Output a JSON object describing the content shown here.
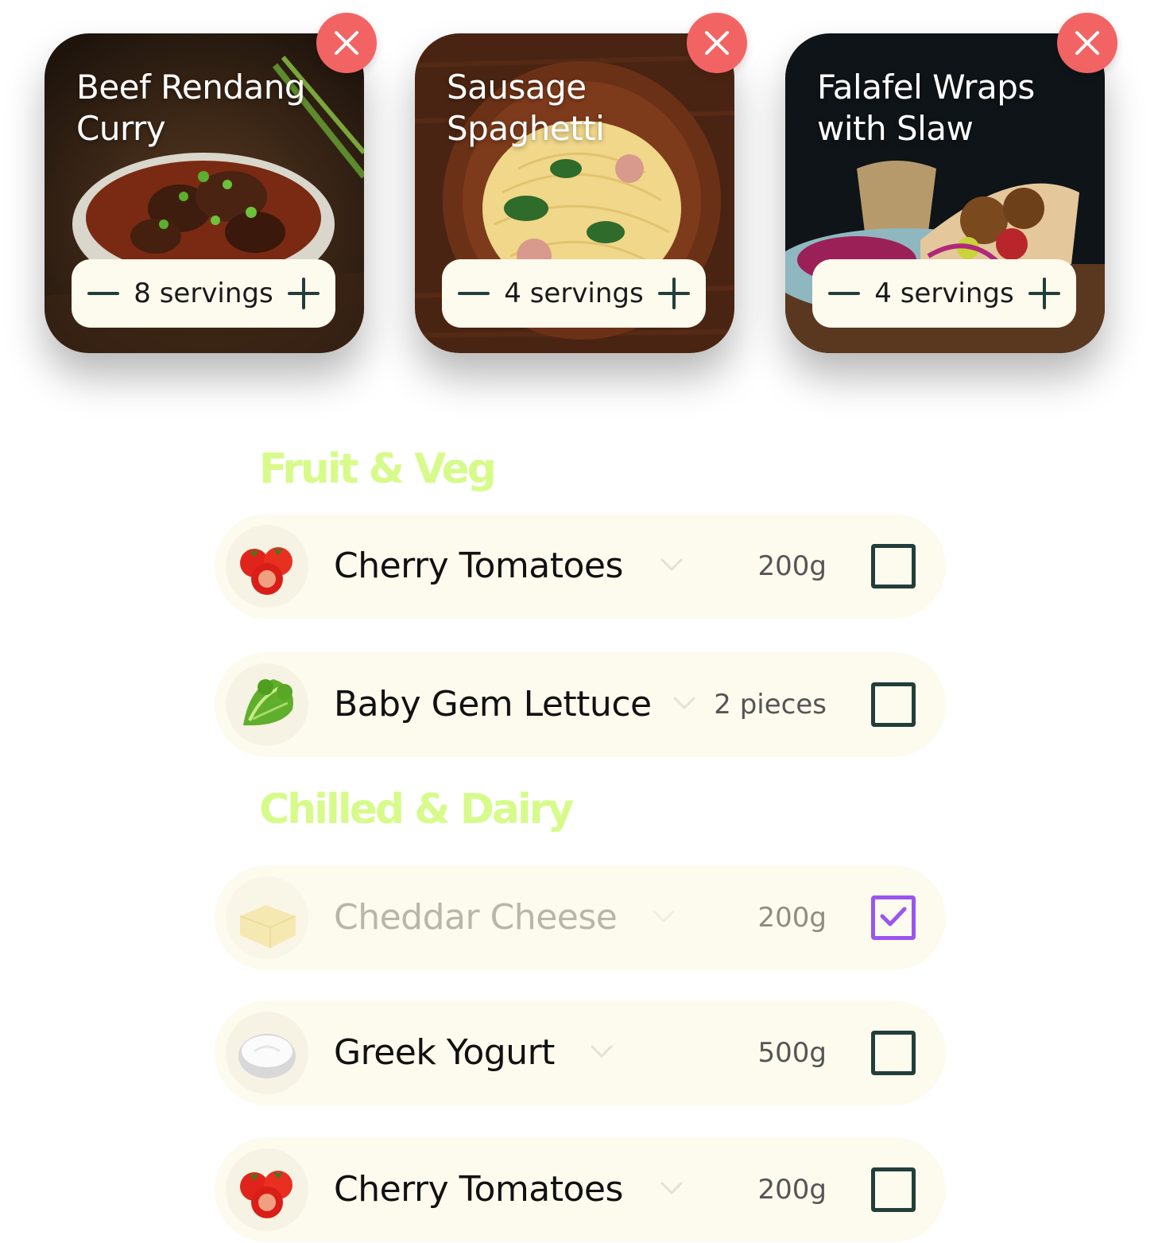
{
  "recipes": [
    {
      "title": "Beef Rendang Curry",
      "servings": "8 servings",
      "photo": "beef-rendang-photo"
    },
    {
      "title": "Sausage Spaghetti",
      "servings": "4 servings",
      "photo": "sausage-spaghetti-photo"
    },
    {
      "title": "Falafel Wraps with Slaw",
      "servings": "4 servings",
      "photo": "falafel-wraps-photo"
    }
  ],
  "sections": [
    {
      "title": "Fruit & Veg",
      "items": [
        {
          "name": "Cherry Tomatoes",
          "qty": "200g",
          "checked": false,
          "icon": "tomato-icon"
        },
        {
          "name": "Baby Gem Lettuce",
          "qty": "2 pieces",
          "checked": false,
          "icon": "lettuce-icon"
        }
      ]
    },
    {
      "title": "Chilled & Dairy",
      "items": [
        {
          "name": "Cheddar Cheese",
          "qty": "200g",
          "checked": true,
          "icon": "cheese-icon"
        },
        {
          "name": "Greek Yogurt",
          "qty": "500g",
          "checked": false,
          "icon": "yogurt-icon"
        },
        {
          "name": "Cherry Tomatoes",
          "qty": "200g",
          "checked": false,
          "icon": "tomato-icon"
        }
      ]
    }
  ],
  "colors": {
    "close_button": "#f26464",
    "section_title": "#d6fb8a",
    "item_background": "#fdfbee",
    "checkbox_border": "#233e3a",
    "checkbox_checked": "#9a55f0"
  }
}
